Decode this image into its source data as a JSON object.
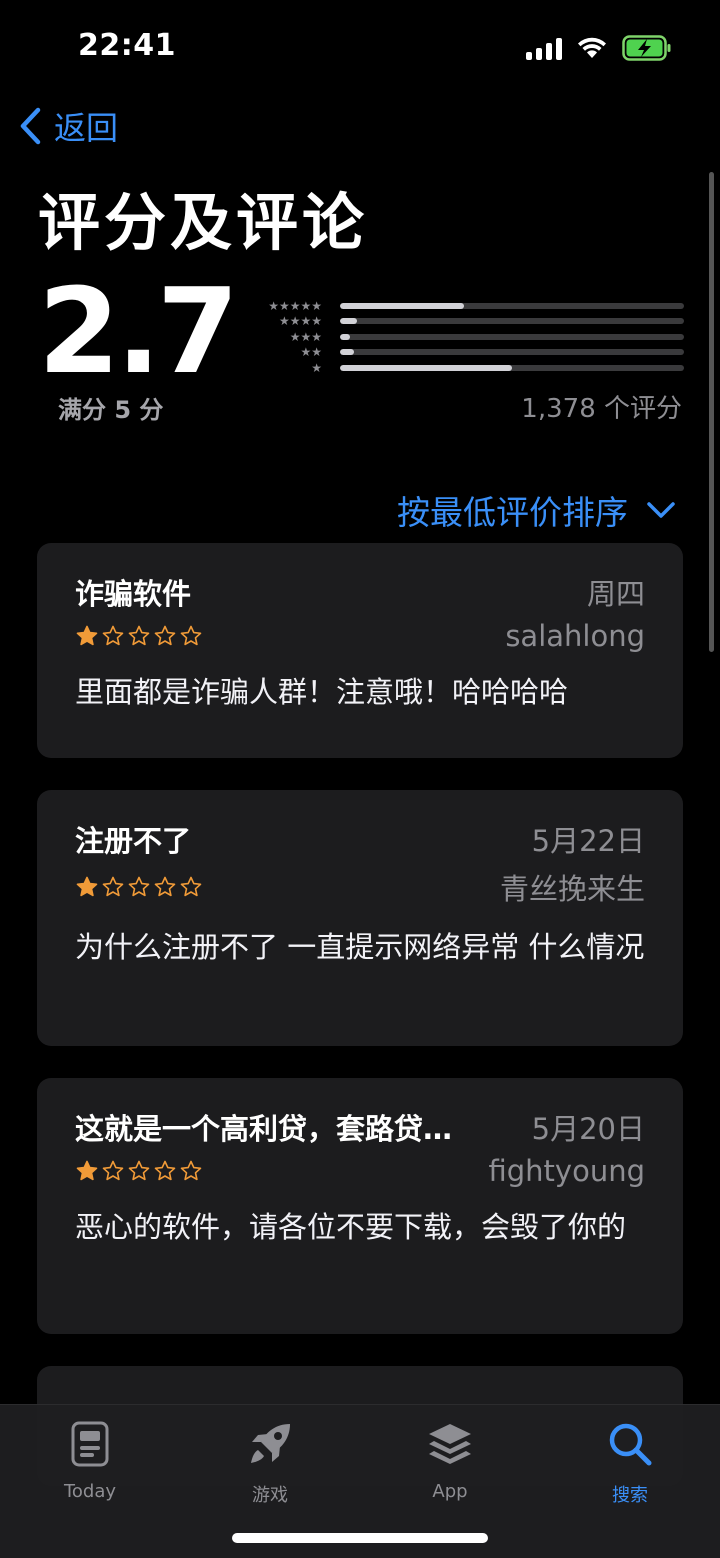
{
  "status": {
    "time": "22:41"
  },
  "nav": {
    "back_label": "返回"
  },
  "page_title": "评分及评论",
  "summary": {
    "average": "2.7",
    "out_of": "满分 5 分",
    "count": "1,378 个评分",
    "histogram": [
      {
        "stars": "★★★★★",
        "fraction": 0.36
      },
      {
        "stars": "★★★★",
        "fraction": 0.05
      },
      {
        "stars": "★★★",
        "fraction": 0.03
      },
      {
        "stars": "★★",
        "fraction": 0.04
      },
      {
        "stars": "★",
        "fraction": 0.5
      }
    ]
  },
  "sort": {
    "label": "按最低评价排序"
  },
  "reviews": [
    {
      "title": "诈骗软件",
      "date": "周四",
      "author": "salahlong",
      "rating": 1,
      "body": "里面都是诈骗人群！注意哦！哈哈哈哈"
    },
    {
      "title": "注册不了",
      "date": "5月22日",
      "author": "青丝挽来生",
      "rating": 1,
      "body": "为什么注册不了 一直提示网络异常 什么情况"
    },
    {
      "title": "这就是一个高利贷，套路贷…",
      "date": "5月20日",
      "author": "fightyoung",
      "rating": 1,
      "body": "恶心的软件，请各位不要下载，会毁了你的"
    }
  ],
  "tabs": [
    {
      "label": "Today",
      "icon": "today-icon",
      "active": false
    },
    {
      "label": "游戏",
      "icon": "rocket-icon",
      "active": false
    },
    {
      "label": "App",
      "icon": "app-stack-icon",
      "active": false
    },
    {
      "label": "搜索",
      "icon": "search-icon",
      "active": true
    }
  ],
  "colors": {
    "accent": "#3a8ff7",
    "star": "#f19b38",
    "card": "#1c1c1e"
  }
}
